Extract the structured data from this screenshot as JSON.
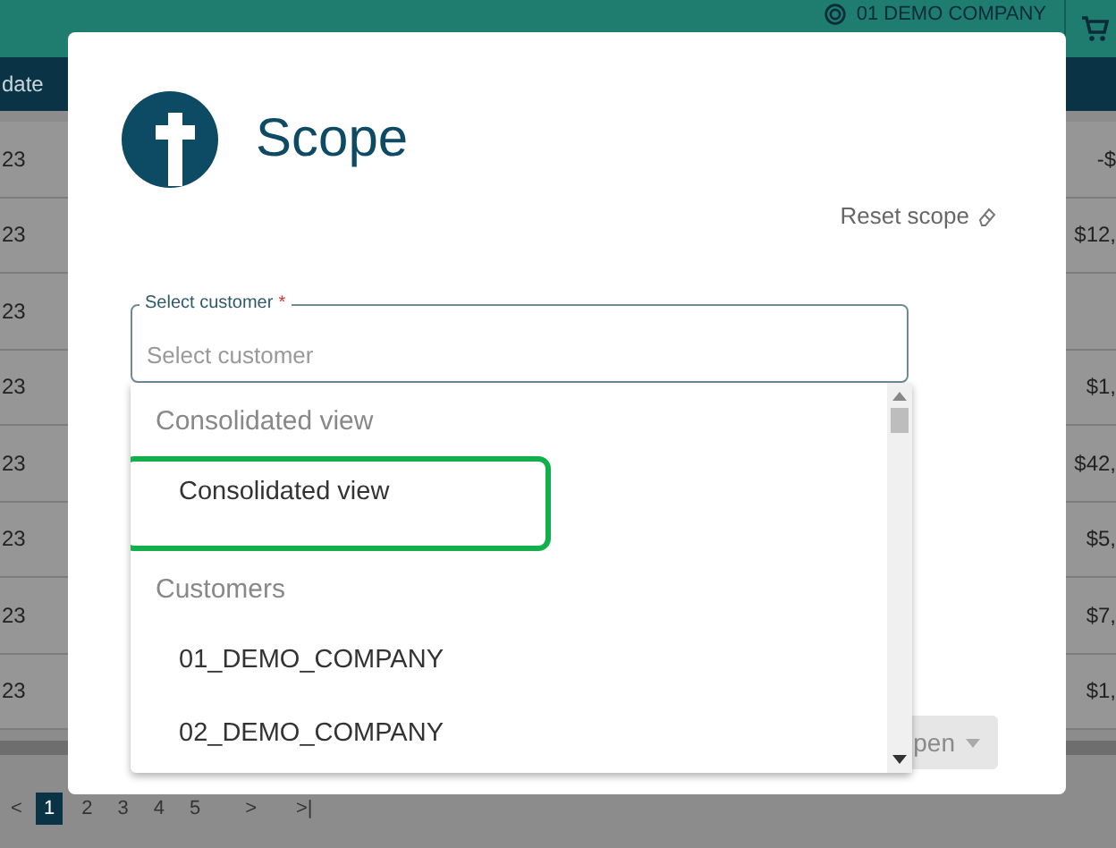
{
  "top_bar": {
    "company": "01 DEMO COMPANY"
  },
  "table": {
    "columns": [
      "date"
    ],
    "rows": [
      {
        "column_1": "23",
        "column_2": "-$"
      },
      {
        "column_1": "23",
        "column_2": "$12,"
      },
      {
        "column_1": "23",
        "column_2": ""
      },
      {
        "column_1": "23",
        "column_2": "$1,"
      },
      {
        "column_1": "23",
        "column_2": "$42,"
      },
      {
        "column_1": "23",
        "column_2": "$5,"
      },
      {
        "column_1": "23",
        "column_2": "$7,"
      },
      {
        "column_1": "23",
        "column_2": "$1,"
      }
    ]
  },
  "pagination": {
    "prev": "<",
    "pages": [
      {
        "label": "1",
        "selected": true
      },
      {
        "label": "2",
        "selected": false
      },
      {
        "label": "3",
        "selected": false
      },
      {
        "label": "4",
        "selected": false
      },
      {
        "label": "5",
        "selected": false
      }
    ],
    "next": ">",
    "last": ">|"
  },
  "dialog": {
    "title": "Scope",
    "reset": "Reset scope",
    "field": {
      "label": "Select customer",
      "required_mark": "*",
      "placeholder": "Select customer"
    },
    "dropdown": [
      {
        "kind": "group",
        "label": "Consolidated view"
      },
      {
        "kind": "option",
        "label": "Consolidated view",
        "highlighted": true
      },
      {
        "kind": "group",
        "label": "Customers"
      },
      {
        "kind": "option",
        "label": "01_DEMO_COMPANY",
        "highlighted": false
      },
      {
        "kind": "option",
        "label": "02_DEMO_COMPANY",
        "highlighted": false
      }
    ],
    "open_button": {
      "label": "pen",
      "disabled": true
    }
  }
}
